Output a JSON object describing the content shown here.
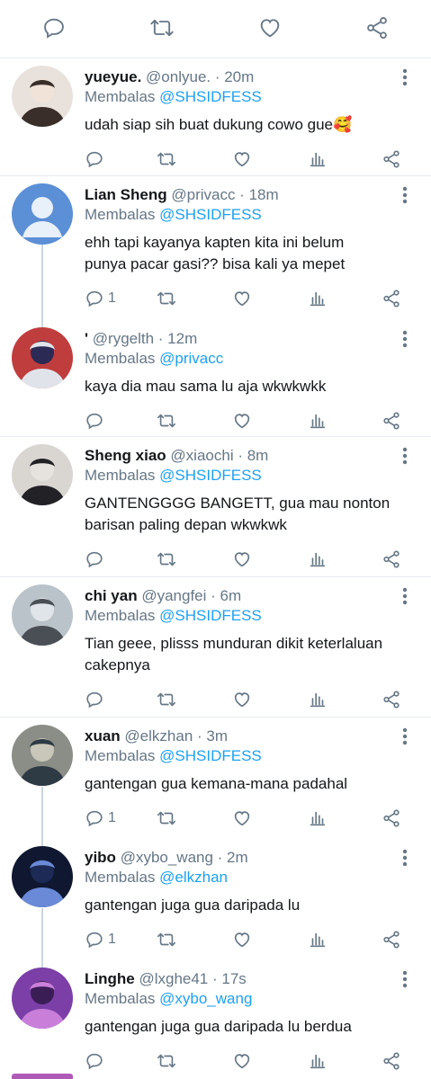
{
  "colors": {
    "link": "#1da1f2",
    "muted": "#657786",
    "text": "#14171a",
    "line": "#ccd6dd"
  },
  "topbar": {
    "icons": [
      "reply-icon",
      "retweet-icon",
      "like-icon",
      "share-icon"
    ]
  },
  "tweets": [
    {
      "name": "yueyue.",
      "meta": "@onlyue. · 20m",
      "reply_prefix": "Membalas ",
      "reply_to": "@SHSIDFESS",
      "lines": [
        "udah siap sih buat dukung cowo gue🥰"
      ],
      "reply_count": ""
    },
    {
      "name": "Lian Sheng",
      "meta": "@privacc · 18m",
      "reply_prefix": "Membalas ",
      "reply_to": "@SHSIDFESS",
      "lines": [
        "ehh tapi kayanya kapten kita ini belum",
        "punya pacar gasi?? bisa kali ya mepet"
      ],
      "reply_count": "1"
    },
    {
      "name": "'",
      "meta": "@rygelth · 12m",
      "reply_prefix": "Membalas ",
      "reply_to": "@privacc",
      "lines": [
        "kaya dia mau sama lu aja wkwkwkk"
      ],
      "reply_count": ""
    },
    {
      "name": "Sheng xiao",
      "meta": "@xiaochi · 8m",
      "reply_prefix": "Membalas ",
      "reply_to": "@SHSIDFESS",
      "lines": [
        "GANTENGGGG BANGETT, gua mau nonton",
        "barisan paling depan wkwkwk"
      ],
      "reply_count": ""
    },
    {
      "name": "chi yan",
      "meta": "@yangfei · 6m",
      "reply_prefix": "Membalas ",
      "reply_to": "@SHSIDFESS",
      "lines": [
        "Tian geee,  plisss munduran dikit keterlaluan",
        "cakepnya"
      ],
      "reply_count": ""
    },
    {
      "name": "xuan",
      "meta": "@elkzhan · 3m",
      "reply_prefix": "Membalas ",
      "reply_to": "@SHSIDFESS",
      "lines": [
        "gantengan gua kemana-mana padahal"
      ],
      "reply_count": "1"
    },
    {
      "name": "yibo",
      "meta": "@xybo_wang · 2m",
      "reply_prefix": "Membalas ",
      "reply_to": "@elkzhan",
      "lines": [
        "gantengan juga gua daripada lu"
      ],
      "reply_count": "1"
    },
    {
      "name": "Linghe",
      "meta": "@lxghe41 · 17s",
      "reply_prefix": "Membalas ",
      "reply_to": "@xybo_wang",
      "lines": [
        "gantengan juga gua daripada lu berdua"
      ],
      "reply_count": ""
    }
  ]
}
